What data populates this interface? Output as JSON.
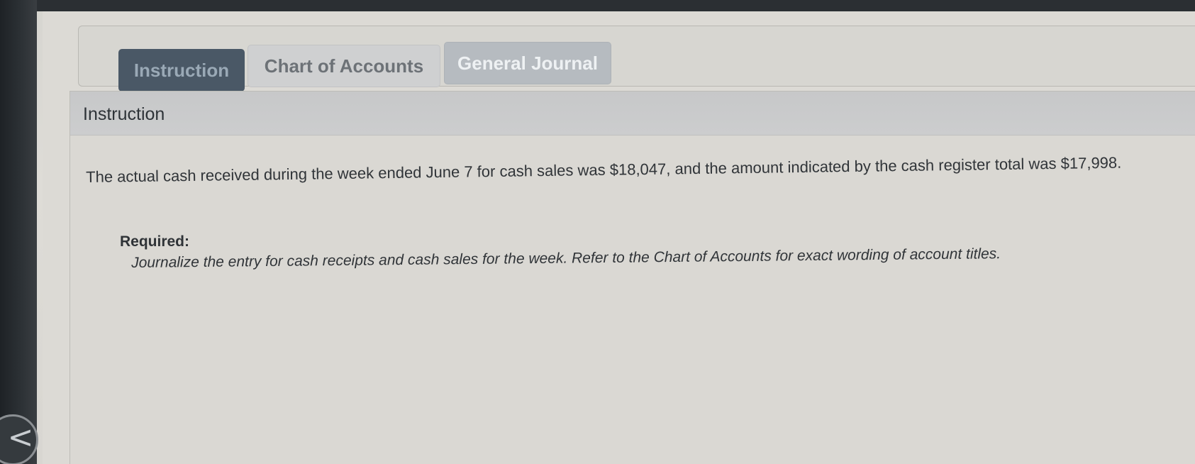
{
  "tabs": [
    {
      "label": "Instruction",
      "active": true
    },
    {
      "label": "Chart of Accounts",
      "active": false
    },
    {
      "label": "General Journal",
      "active": false
    }
  ],
  "instruction_panel": {
    "title": "Instruction",
    "body": "The actual cash received during the week ended June 7 for cash sales was $18,047, and the amount indicated by the cash register total was $17,998.",
    "required_label": "Required:",
    "required_text": "Journalize the entry for cash receipts and cash sales for the week. Refer to the Chart of Accounts for exact wording of account titles."
  },
  "nav": {
    "back_icon": "chevron-left-icon",
    "back_glyph": "<"
  },
  "colors": {
    "active_tab_bg": "#4a5866",
    "journal_tab_bg": "#b6bbc0",
    "header_bg": "#c7c8c9"
  }
}
